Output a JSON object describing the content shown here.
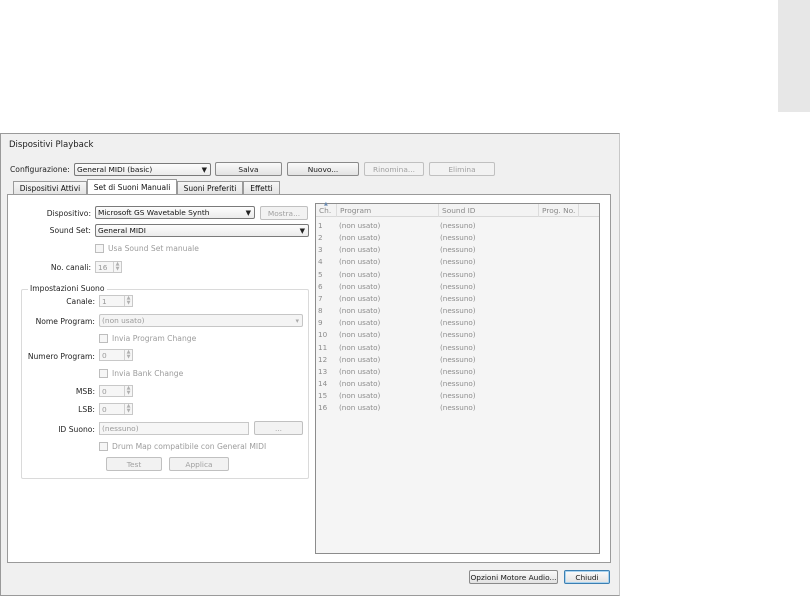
{
  "window": {
    "title": "Dispositivi Playback"
  },
  "config": {
    "label": "Configurazione:",
    "value": "General MIDI (basic)",
    "buttons": {
      "save": "Salva",
      "new": "Nuovo...",
      "rename": "Rinomina...",
      "delete": "Elimina"
    }
  },
  "tabs": [
    "Dispositivi Attivi",
    "Set di Suoni Manuali",
    "Suoni Preferiti",
    "Effetti"
  ],
  "left": {
    "device_label": "Dispositivo:",
    "device_value": "Microsoft GS Wavetable Synth",
    "show_button": "Mostra...",
    "soundset_label": "Sound Set:",
    "soundset_value": "General MIDI",
    "manual_soundset": "Usa Sound Set manuale",
    "channels_label": "No. canali:",
    "channels_value": "16"
  },
  "group": {
    "title": "Impostazioni Suono",
    "channel_label": "Canale:",
    "channel_value": "1",
    "program_name_label": "Nome Program:",
    "program_name_value": "(non usato)",
    "send_program_change": "Invia Program Change",
    "program_number_label": "Numero Program:",
    "program_number_value": "0",
    "send_bank_change": "Invia Bank Change",
    "msb_label": "MSB:",
    "msb_value": "0",
    "lsb_label": "LSB:",
    "lsb_value": "0",
    "sound_id_label": "ID Suono:",
    "sound_id_value": "(nessuno)",
    "browse_button": "...",
    "drum_map": "Drum Map compatibile con General MIDI",
    "test_button": "Test",
    "apply_button": "Applica"
  },
  "list": {
    "columns": [
      "Ch.",
      "Program",
      "Sound ID",
      "Prog. No."
    ],
    "rows": [
      {
        "ch": "1",
        "program": "(non usato)",
        "sound_id": "(nessuno)"
      },
      {
        "ch": "2",
        "program": "(non usato)",
        "sound_id": "(nessuno)"
      },
      {
        "ch": "3",
        "program": "(non usato)",
        "sound_id": "(nessuno)"
      },
      {
        "ch": "4",
        "program": "(non usato)",
        "sound_id": "(nessuno)"
      },
      {
        "ch": "5",
        "program": "(non usato)",
        "sound_id": "(nessuno)"
      },
      {
        "ch": "6",
        "program": "(non usato)",
        "sound_id": "(nessuno)"
      },
      {
        "ch": "7",
        "program": "(non usato)",
        "sound_id": "(nessuno)"
      },
      {
        "ch": "8",
        "program": "(non usato)",
        "sound_id": "(nessuno)"
      },
      {
        "ch": "9",
        "program": "(non usato)",
        "sound_id": "(nessuno)"
      },
      {
        "ch": "10",
        "program": "(non usato)",
        "sound_id": "(nessuno)"
      },
      {
        "ch": "11",
        "program": "(non usato)",
        "sound_id": "(nessuno)"
      },
      {
        "ch": "12",
        "program": "(non usato)",
        "sound_id": "(nessuno)"
      },
      {
        "ch": "13",
        "program": "(non usato)",
        "sound_id": "(nessuno)"
      },
      {
        "ch": "14",
        "program": "(non usato)",
        "sound_id": "(nessuno)"
      },
      {
        "ch": "15",
        "program": "(non usato)",
        "sound_id": "(nessuno)"
      },
      {
        "ch": "16",
        "program": "(non usato)",
        "sound_id": "(nessuno)"
      }
    ]
  },
  "footer": {
    "audio_options": "Opzioni Motore Audio...",
    "close": "Chiudi"
  },
  "colors": {
    "dialog_bg": "#f0f0f0",
    "default_button_border": "#3c7fb1",
    "disabled_text": "#9c9c9c"
  }
}
